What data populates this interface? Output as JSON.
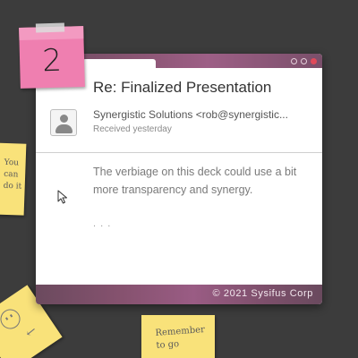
{
  "sticky_notes": {
    "pink_number": "2",
    "left_note": "You\ncan\ndo it",
    "bottom_note": "Remember\nto go"
  },
  "email": {
    "subject": "Re: Finalized Presentation",
    "sender": "Synergistic Solutions <rob@synergistic...",
    "received": "Received yesterday",
    "body": "The verbiage on this deck could use a bit more transparency and synergy.",
    "ellipsis": ". . ."
  },
  "footer": {
    "copyright": "© 2021 Sysifus Corp"
  },
  "icons": {
    "avatar": "person-icon",
    "cursor": "mouse-pointer-icon",
    "smiley": "smiley-face-icon",
    "arrow": "arrow-down-left-icon"
  },
  "colors": {
    "background": "#3c3c3c",
    "sticky_pink": "#ef7fb0",
    "sticky_yellow": "#f9e27a",
    "window_bar": "#8a5573",
    "close_button": "#e04a5a"
  }
}
